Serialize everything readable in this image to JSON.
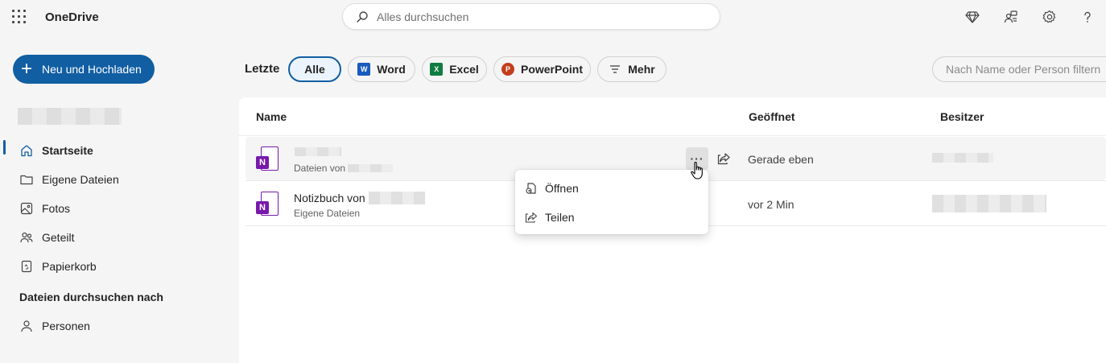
{
  "header": {
    "app_title": "OneDrive",
    "search_placeholder": "Alles durchsuchen"
  },
  "sidebar": {
    "new_button": "Neu und Hochladen",
    "items": [
      {
        "label": "Startseite",
        "icon": "home-icon",
        "active": true
      },
      {
        "label": "Eigene Dateien",
        "icon": "folder-icon",
        "active": false
      },
      {
        "label": "Fotos",
        "icon": "photo-icon",
        "active": false
      },
      {
        "label": "Geteilt",
        "icon": "people-icon",
        "active": false
      },
      {
        "label": "Papierkorb",
        "icon": "recycle-bin-icon",
        "active": false
      }
    ],
    "browse_section": "Dateien durchsuchen nach",
    "browse_items": [
      {
        "label": "Personen",
        "icon": "person-icon"
      }
    ]
  },
  "filter_bar": {
    "label": "Letzte",
    "chips": [
      {
        "label": "Alle",
        "active": true
      },
      {
        "label": "Word",
        "icon": "word-icon"
      },
      {
        "label": "Excel",
        "icon": "excel-icon"
      },
      {
        "label": "PowerPoint",
        "icon": "powerpoint-icon"
      },
      {
        "label": "Mehr",
        "icon": "filter-icon"
      }
    ],
    "filter_placeholder": "Nach Name oder Person filtern"
  },
  "table": {
    "columns": [
      "Name",
      "Geöffnet",
      "Besitzer"
    ],
    "rows": [
      {
        "name": "",
        "subtitle": "Dateien von",
        "opened": "Gerade eben",
        "owner": ""
      },
      {
        "name": "Notizbuch von",
        "subtitle": "Eigene Dateien",
        "opened": "vor 2 Min",
        "owner": ""
      }
    ]
  },
  "context_menu": {
    "items": [
      {
        "label": "Öffnen",
        "icon": "open-icon"
      },
      {
        "label": "Teilen",
        "icon": "share-icon"
      }
    ]
  },
  "colors": {
    "accent": "#115ea3",
    "onenote": "#7719aa",
    "word": "#185abd",
    "excel": "#107c41",
    "powerpoint": "#c43e1c"
  }
}
